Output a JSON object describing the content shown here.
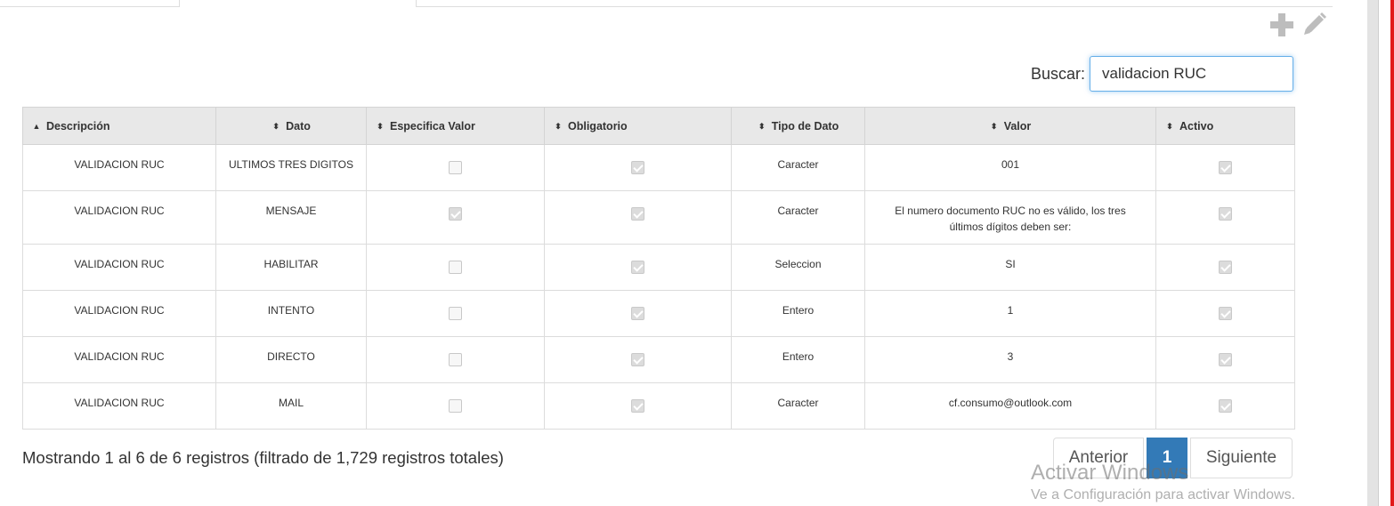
{
  "toolbar": {
    "add_icon": "plus-icon",
    "edit_icon": "pencil-icon"
  },
  "search": {
    "label": "Buscar:",
    "value": "validacion RUC"
  },
  "table": {
    "columns": [
      "Descripción",
      "Dato",
      "Especifica Valor",
      "Obligatorio",
      "Tipo de Dato",
      "Valor",
      "Activo"
    ],
    "sorted_column": "Descripción",
    "rows": [
      {
        "descripcion": "VALIDACION RUC",
        "dato": "ULTIMOS TRES DIGITOS",
        "especifica_valor": false,
        "obligatorio": true,
        "tipo": "Caracter",
        "valor": "001",
        "activo": true
      },
      {
        "descripcion": "VALIDACION RUC",
        "dato": "MENSAJE",
        "especifica_valor": true,
        "obligatorio": true,
        "tipo": "Caracter",
        "valor_line1": "El numero documento RUC no es válido, los tres",
        "valor_line2": "últimos dígitos deben ser:",
        "activo": true
      },
      {
        "descripcion": "VALIDACION RUC",
        "dato": "HABILITAR",
        "especifica_valor": false,
        "obligatorio": true,
        "tipo": "Seleccion",
        "valor": "SI",
        "activo": true
      },
      {
        "descripcion": "VALIDACION RUC",
        "dato": "INTENTO",
        "especifica_valor": false,
        "obligatorio": true,
        "tipo": "Entero",
        "valor": "1",
        "activo": true
      },
      {
        "descripcion": "VALIDACION RUC",
        "dato": "DIRECTO",
        "especifica_valor": false,
        "obligatorio": true,
        "tipo": "Entero",
        "valor": "3",
        "activo": true
      },
      {
        "descripcion": "VALIDACION RUC",
        "dato": "MAIL",
        "especifica_valor": false,
        "obligatorio": true,
        "tipo": "Caracter",
        "valor": "cf.consumo@outlook.com",
        "activo": true
      }
    ]
  },
  "footer": {
    "info": "Mostrando 1 al 6 de 6 registros (filtrado de 1,729 registros totales)"
  },
  "pagination": {
    "prev": "Anterior",
    "current": "1",
    "next": "Siguiente"
  },
  "watermark": {
    "title": "Activar Windows",
    "subtitle": "Ve a Configuración para activar Windows."
  },
  "colors": {
    "accent": "#337ab7",
    "header_bg": "#e8e8e8",
    "edge_red": "#e21b1b"
  }
}
